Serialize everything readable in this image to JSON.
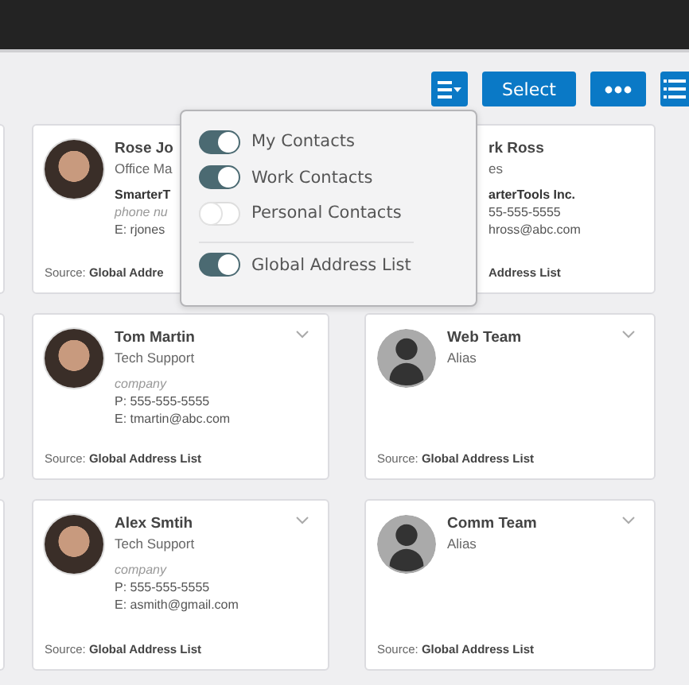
{
  "toolbar": {
    "select_label": "Select"
  },
  "cards": [
    {
      "kind": "person",
      "name": "Rose Jo",
      "title": "Office Ma",
      "lines": [
        {
          "kind": "company",
          "text": "SmarterT"
        },
        {
          "kind": "placeholder",
          "text": "phone nu"
        },
        {
          "kind": "text",
          "text": "E: rjones"
        }
      ],
      "source_prefix": "Source:",
      "source": "Global Addre"
    },
    {
      "kind": "covered",
      "name": "rk Ross",
      "title": "es",
      "lines": [
        {
          "kind": "company",
          "text": "arterTools Inc."
        },
        {
          "kind": "text",
          "text": "55-555-5555"
        },
        {
          "kind": "text",
          "text": "hross@abc.com"
        }
      ],
      "source": "Address List"
    },
    {
      "kind": "person",
      "name": "Tom Martin",
      "title": "Tech Support",
      "lines": [
        {
          "kind": "placeholder",
          "text": "company"
        },
        {
          "kind": "text",
          "text": "P: 555-555-5555"
        },
        {
          "kind": "text",
          "text": "E: tmartin@abc.com"
        }
      ],
      "source_prefix": "Source:",
      "source": "Global Address List"
    },
    {
      "kind": "group",
      "name": "Web Team",
      "title": "Alias",
      "source_prefix": "Source:",
      "source": "Global Address List"
    },
    {
      "kind": "person",
      "name": "Alex Smtih",
      "title": "Tech Support",
      "lines": [
        {
          "kind": "placeholder",
          "text": "company"
        },
        {
          "kind": "text",
          "text": "P: 555-555-5555"
        },
        {
          "kind": "text",
          "text": "E: asmith@gmail.com"
        }
      ],
      "source_prefix": "Source:",
      "source": "Global Address List"
    },
    {
      "kind": "group",
      "name": "Comm Team",
      "title": "Alias",
      "source_prefix": "Source:",
      "source": "Global Address List"
    }
  ],
  "filter_menu": {
    "items": [
      {
        "label": "My Contacts",
        "on": true
      },
      {
        "label": "Work Contacts",
        "on": true
      },
      {
        "label": "Personal Contacts",
        "on": false
      },
      {
        "label": "Global Address List",
        "on": true,
        "separated": true
      }
    ]
  }
}
